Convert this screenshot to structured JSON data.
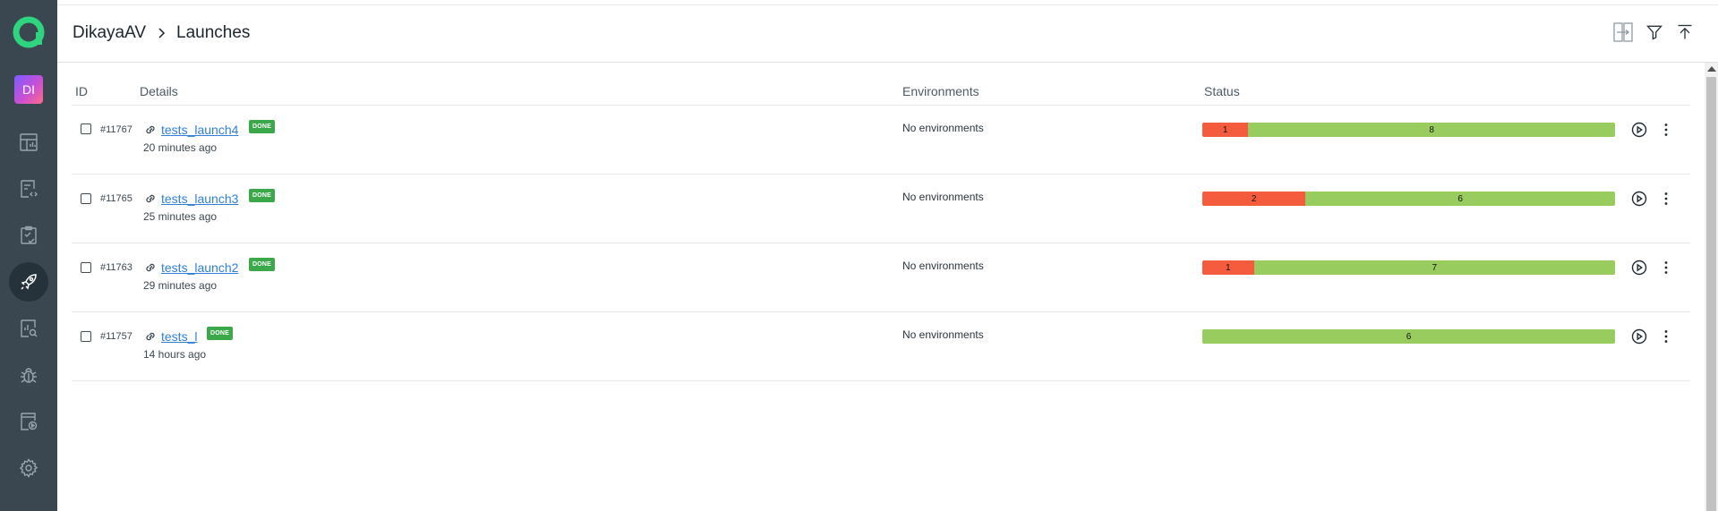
{
  "sidebar": {
    "avatar": "DI",
    "nav": [
      {
        "icon": "dashboard-icon",
        "active": false
      },
      {
        "icon": "test-cases-icon",
        "active": false
      },
      {
        "icon": "test-plans-icon",
        "active": false
      },
      {
        "icon": "launches-rocket-icon",
        "active": true
      },
      {
        "icon": "analytics-icon",
        "active": false
      },
      {
        "icon": "defects-bug-icon",
        "active": false
      },
      {
        "icon": "jobs-icon",
        "active": false
      },
      {
        "icon": "settings-gear-icon",
        "active": false
      }
    ]
  },
  "header": {
    "project": "DikayaAV",
    "page": "Launches"
  },
  "table": {
    "columns": {
      "id": "ID",
      "details": "Details",
      "environments": "Environments",
      "status": "Status"
    },
    "rows": [
      {
        "id": "#11767",
        "name": "tests_launch4",
        "badge": "DONE",
        "time": "20 minutes ago",
        "env": "No environments",
        "failed": 1,
        "passed": 8
      },
      {
        "id": "#11765",
        "name": "tests_launch3",
        "badge": "DONE",
        "time": "25 minutes ago",
        "env": "No environments",
        "failed": 2,
        "passed": 6
      },
      {
        "id": "#11763",
        "name": "tests_launch2",
        "badge": "DONE",
        "time": "29 minutes ago",
        "env": "No environments",
        "failed": 1,
        "passed": 7
      },
      {
        "id": "#11757",
        "name": "tests_l",
        "badge": "DONE",
        "time": "14 hours ago",
        "env": "No environments",
        "failed": 0,
        "passed": 6
      }
    ]
  },
  "colors": {
    "sidebar_bg": "#3a4750",
    "failed": "#f45c3d",
    "passed": "#99cc5e",
    "done_badge": "#3ba84a",
    "link": "#2f7fd8"
  }
}
